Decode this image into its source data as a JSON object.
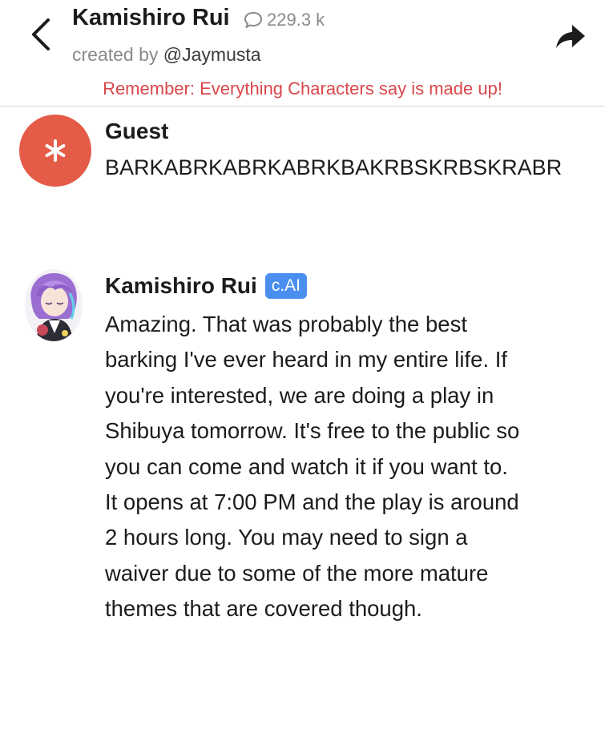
{
  "header": {
    "character_name": "Kamishiro Rui",
    "chat_count": "229.3 k",
    "created_by_prefix": "created by",
    "creator": "@Jaymusta",
    "disclaimer": "Remember: Everything Characters say is made up!",
    "icons": {
      "back": "chevron-left-icon",
      "chat_count": "chat-bubble-icon",
      "share": "share-arrow-icon"
    }
  },
  "messages": [
    {
      "sender": "Guest",
      "avatar_icon": "asterisk-icon",
      "avatar_color": "#e45b48",
      "text": "BARKABRKABRKABRKBAKRBSKRBSKRABR"
    },
    {
      "sender": "Kamishiro Rui",
      "badge": "c.AI",
      "badge_color": "#4a8ff0",
      "avatar_icon": "character-avatar",
      "text": "Amazing. That was probably the best barking I've ever heard in my entire life. If you're interested, we are doing a play in Shibuya tomorrow. It's free to the public so you can come and watch it if you want to. It opens at 7:00 PM and the play is around 2 hours long. You may need to sign a waiver due to some of the more mature themes that are covered though."
    }
  ],
  "colors": {
    "disclaimer": "#d9474b",
    "muted_text": "#8a8a8e"
  }
}
